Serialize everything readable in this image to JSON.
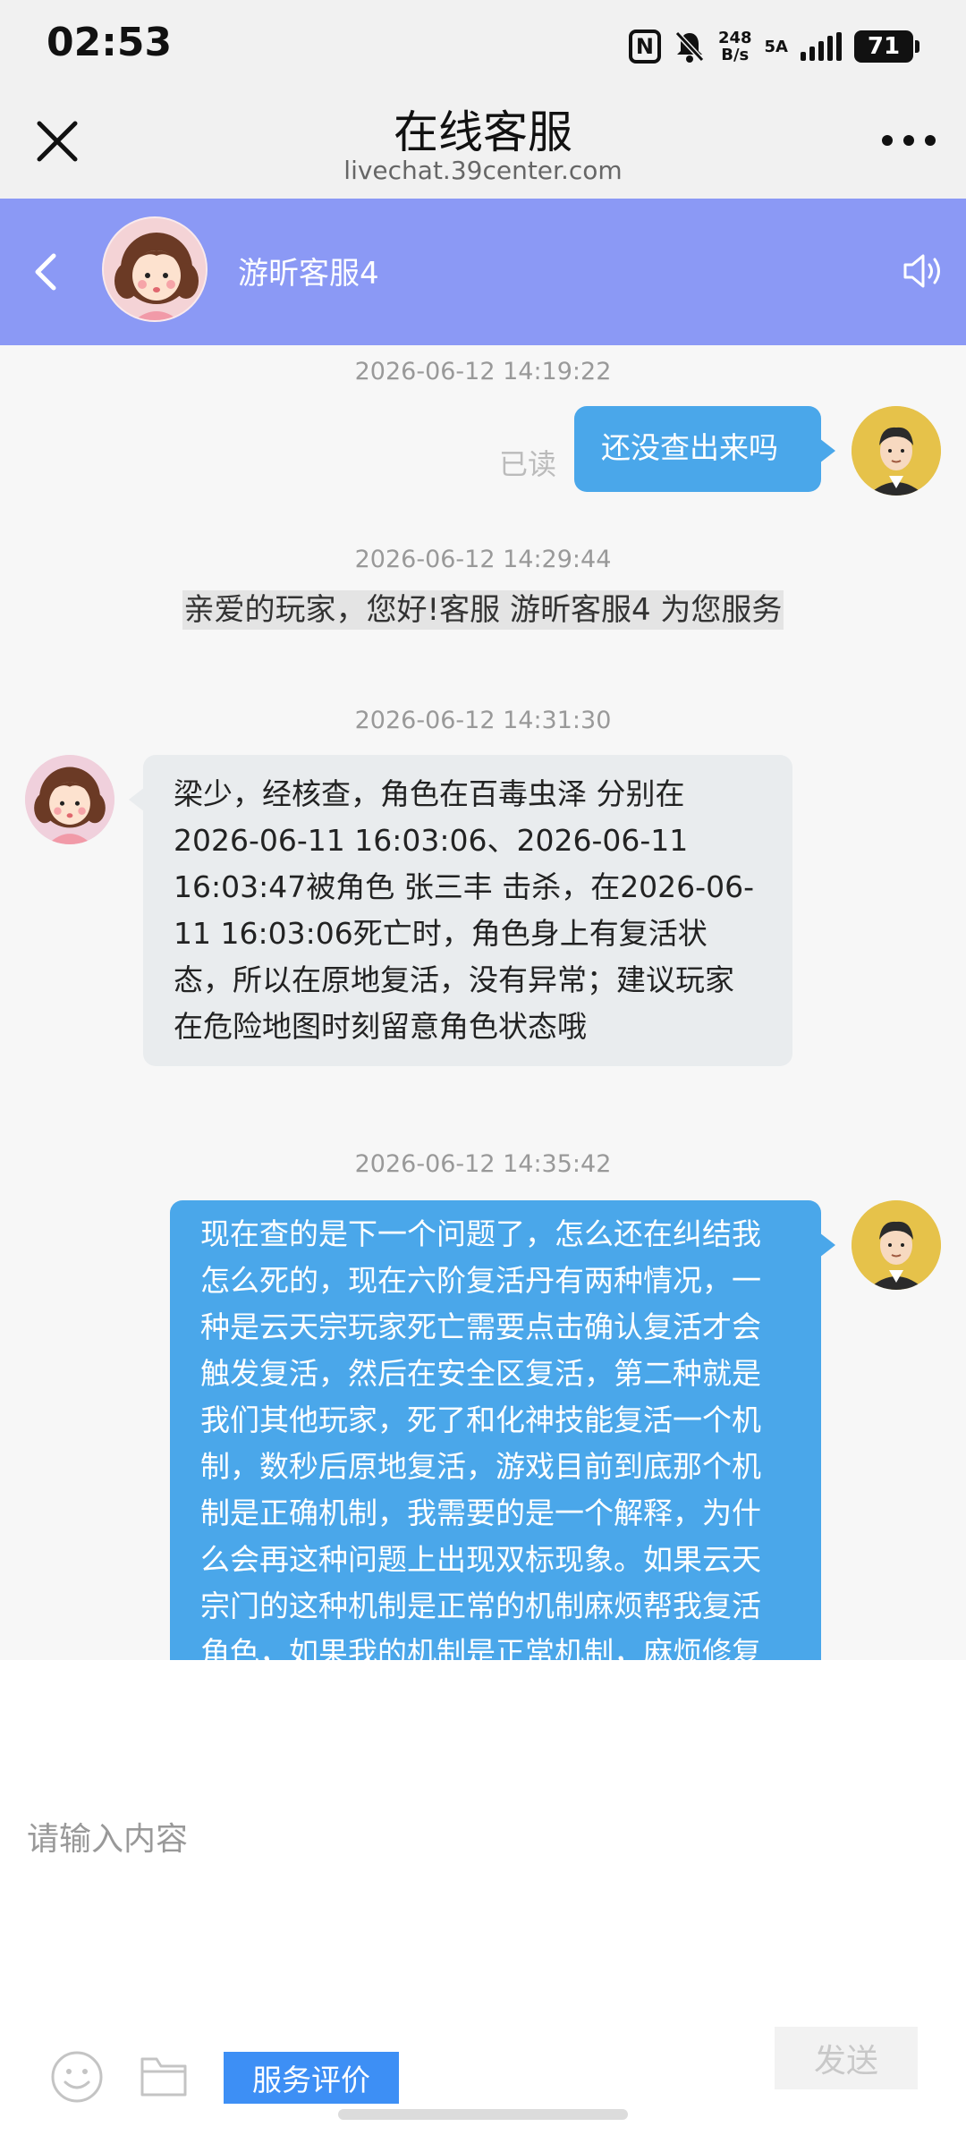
{
  "status_bar": {
    "time": "02:53",
    "nfc": "N",
    "speed_value": "248",
    "speed_unit": "B/s",
    "network": "5A",
    "battery": "71"
  },
  "browser": {
    "title": "在线客服",
    "url": "livechat.39center.com"
  },
  "chat_header": {
    "agent_name": "游昕客服4"
  },
  "messages": [
    {
      "timestamp": "2026-06-12 14:19:22",
      "read": "已读",
      "text": "还没查出来吗"
    },
    {
      "timestamp": "2026-06-12 14:29:44",
      "text": "亲爱的玩家，您好!客服 游昕客服4 为您服务"
    },
    {
      "timestamp": "2026-06-12 14:31:30",
      "lines": [
        "梁少，经核查，角色在百毒虫泽 分别在",
        "2026-06-11 16:03:06、2026-06-11",
        "16:03:47被角色 张三丰 击杀，在2026-06-",
        "11 16:03:06死亡时，角色身上有复活状",
        "态，所以在原地复活，没有异常；建议玩家",
        "在危险地图时刻留意角色状态哦"
      ]
    },
    {
      "timestamp": "2026-06-12 14:35:42",
      "lines": [
        "现在查的是下一个问题了，怎么还在纠结我",
        "怎么死的，现在六阶复活丹有两种情况，一",
        "种是云天宗玩家死亡需要点击确认复活才会",
        "触发复活，然后在安全区复活，第二种就是",
        "我们其他玩家，死了和化神技能复活一个机",
        "制，数秒后原地复活，游戏目前到底那个机",
        "制是正确机制，我需要的是一个解释，为什",
        "么会再这种问题上出现双标现象。如果云天",
        "宗门的这种机制是正常的机制麻烦帮我复活",
        "角色，如果我的机制是正常机制，麻烦修复"
      ]
    }
  ],
  "input": {
    "placeholder": "请输入内容",
    "rate_label": "服务评价",
    "send_label": "发送"
  }
}
